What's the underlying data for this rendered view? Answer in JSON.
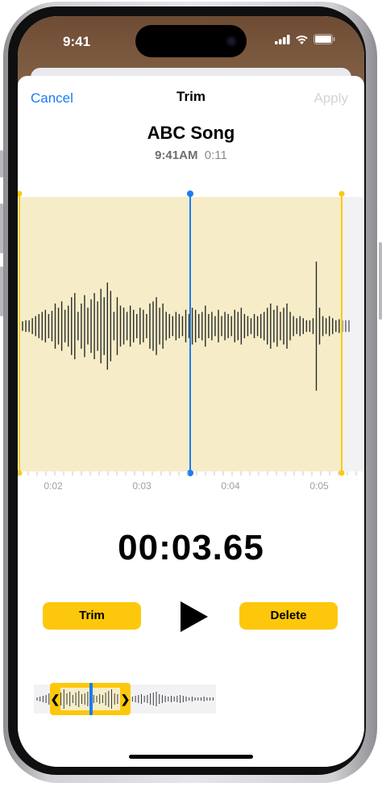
{
  "status_bar": {
    "time": "9:41"
  },
  "nav": {
    "cancel_label": "Cancel",
    "title": "Trim",
    "apply_label": "Apply"
  },
  "recording": {
    "title": "ABC Song",
    "time": "9:41AM",
    "duration": "0:11"
  },
  "timeline": {
    "ticks": [
      "0:02",
      "0:03",
      "0:04",
      "0:05"
    ]
  },
  "playback": {
    "position": "00:03.65"
  },
  "actions": {
    "trim_label": "Trim",
    "delete_label": "Delete"
  },
  "colors": {
    "accent": "#1A7CF4",
    "trim_yellow": "#FDC80B",
    "selection_fill": "#F6EDC8"
  }
}
